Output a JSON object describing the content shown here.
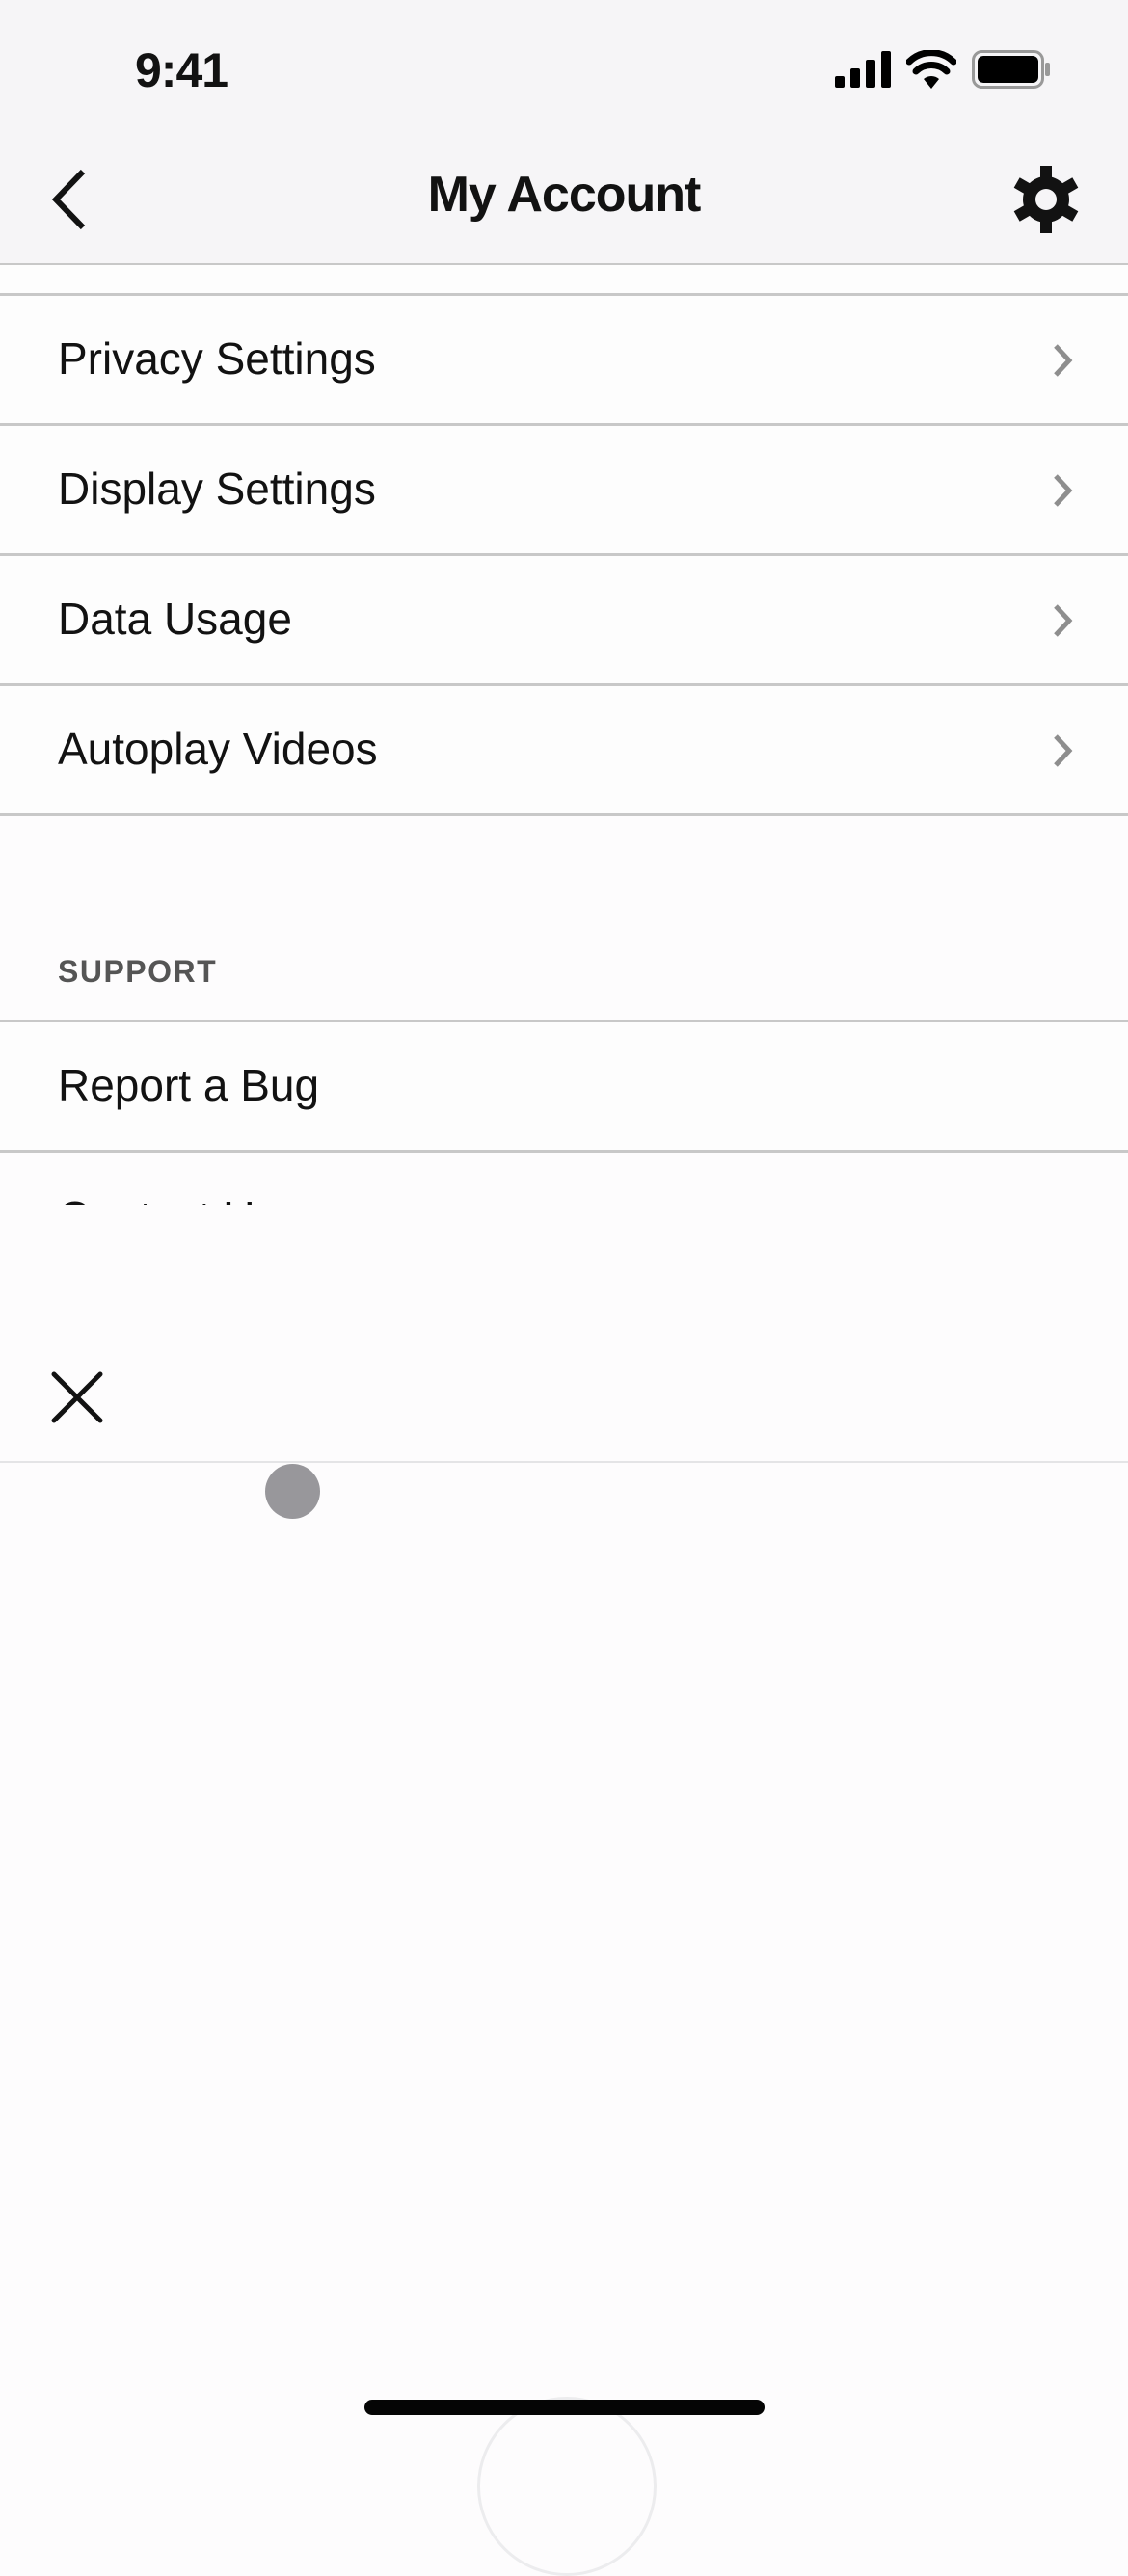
{
  "status_bar": {
    "time": "9:41",
    "icons": [
      "cellular-signal-icon",
      "wifi-icon",
      "battery-icon"
    ]
  },
  "nav": {
    "title": "My Account",
    "back_icon": "chevron-left-icon",
    "settings_icon": "gear-icon"
  },
  "settings_list": {
    "items": [
      {
        "label": "Privacy Settings"
      },
      {
        "label": "Display Settings"
      },
      {
        "label": "Data Usage"
      },
      {
        "label": "Autoplay Videos"
      }
    ]
  },
  "support_section": {
    "header": "SUPPORT",
    "items": [
      {
        "label": "Report a Bug"
      },
      {
        "label": "Contact Us"
      }
    ]
  },
  "sheet": {
    "close_icon": "close-icon"
  },
  "colors": {
    "header_bg": "#f6f5f7",
    "divider": "#c8c8c8",
    "text": "#121212",
    "chevron": "#8e8e8e",
    "section_label": "#555555",
    "touch_indicator": "#98979b"
  }
}
